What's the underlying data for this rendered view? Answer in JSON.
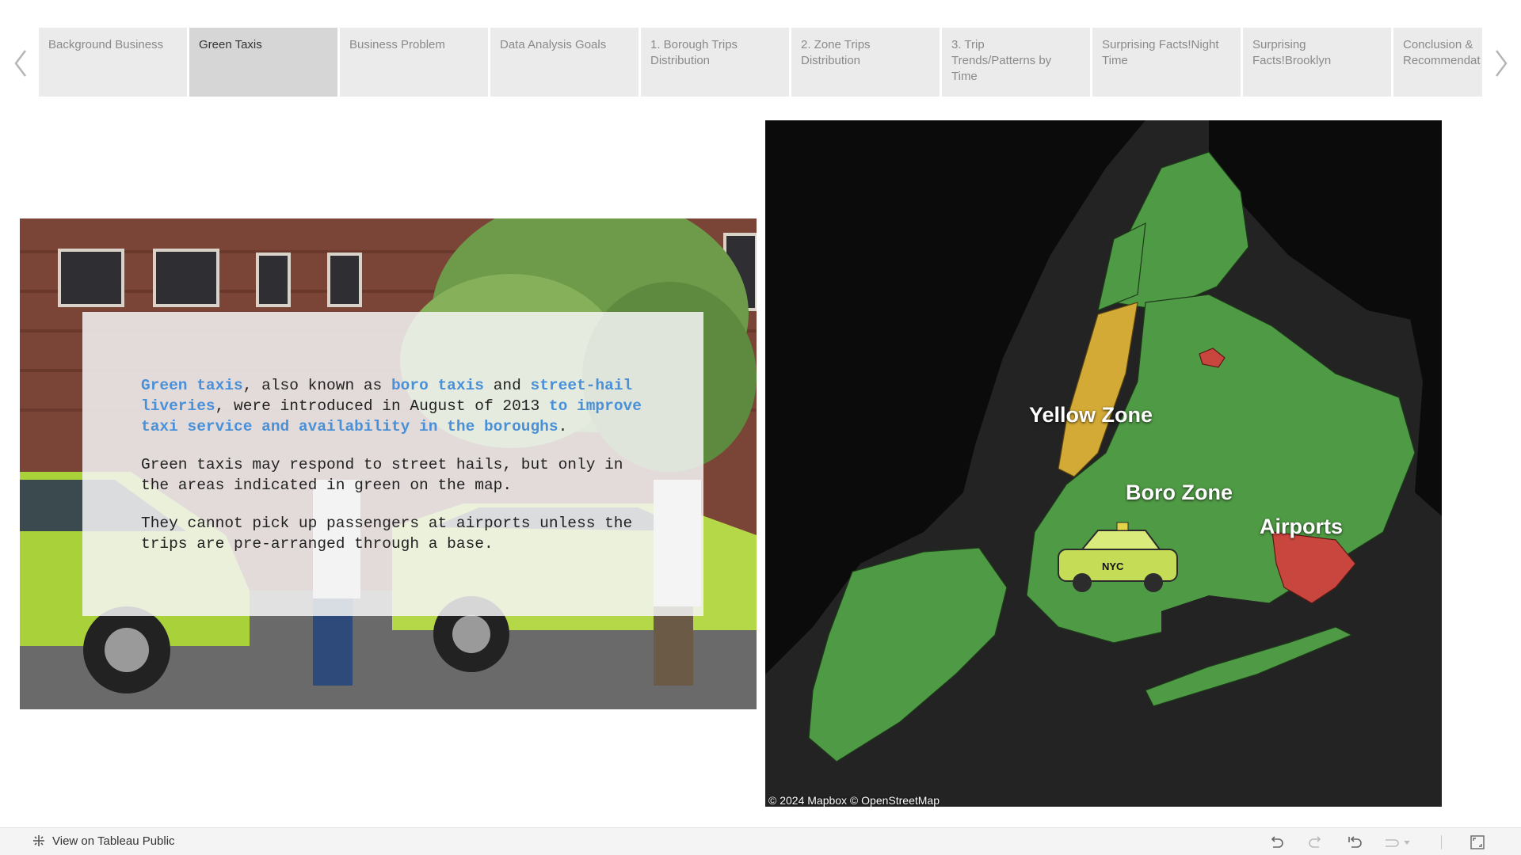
{
  "story_tabs": [
    {
      "label": "Background Business",
      "active": false
    },
    {
      "label": "Green Taxis",
      "active": true
    },
    {
      "label": "Business Problem",
      "active": false
    },
    {
      "label": "Data Analysis Goals",
      "active": false
    },
    {
      "label": "1. Borough Trips\nDistribution",
      "active": false
    },
    {
      "label": "2. Zone Trips\nDistribution",
      "active": false
    },
    {
      "label": "3. Trip\nTrends/Patterns by\nTime",
      "active": false
    },
    {
      "label": "Surprising Facts!Night\nTime",
      "active": false
    },
    {
      "label": "Surprising\nFacts!Brooklyn",
      "active": false
    },
    {
      "label": "Conclusion &\nRecommendat",
      "active": false
    }
  ],
  "text_box": {
    "p1": {
      "s1": "Green taxis",
      "s2": ", also known as ",
      "s3": "boro taxis",
      "s4": " and ",
      "s5": "street-hail liveries",
      "s6": ", were introduced in August of 2013 ",
      "s7": "to improve taxi service and availability in the boroughs",
      "s8": "."
    },
    "p2": "Green taxis may respond to street hails, but only in the areas indicated in green on the map.",
    "p3": "They cannot pick up passengers at airports unless the trips are pre-arranged through a base."
  },
  "map": {
    "labels": {
      "yellow_zone": "Yellow Zone",
      "boro_zone": "Boro Zone",
      "airports": "Airports"
    },
    "taxi_plate": "NYC",
    "attribution": "© 2024 Mapbox © OpenStreetMap",
    "colors": {
      "boro_zone": "#4f9a45",
      "yellow_zone": "#d4aa36",
      "airports": "#c9463f",
      "water": "#232323",
      "land": "#0b0b0b"
    }
  },
  "footer": {
    "tableau_link": "View on Tableau Public",
    "icons": [
      "undo-icon",
      "redo-icon",
      "revert-icon",
      "pause-icon",
      "fullscreen-icon"
    ]
  },
  "accent_color": "#4a90d9"
}
